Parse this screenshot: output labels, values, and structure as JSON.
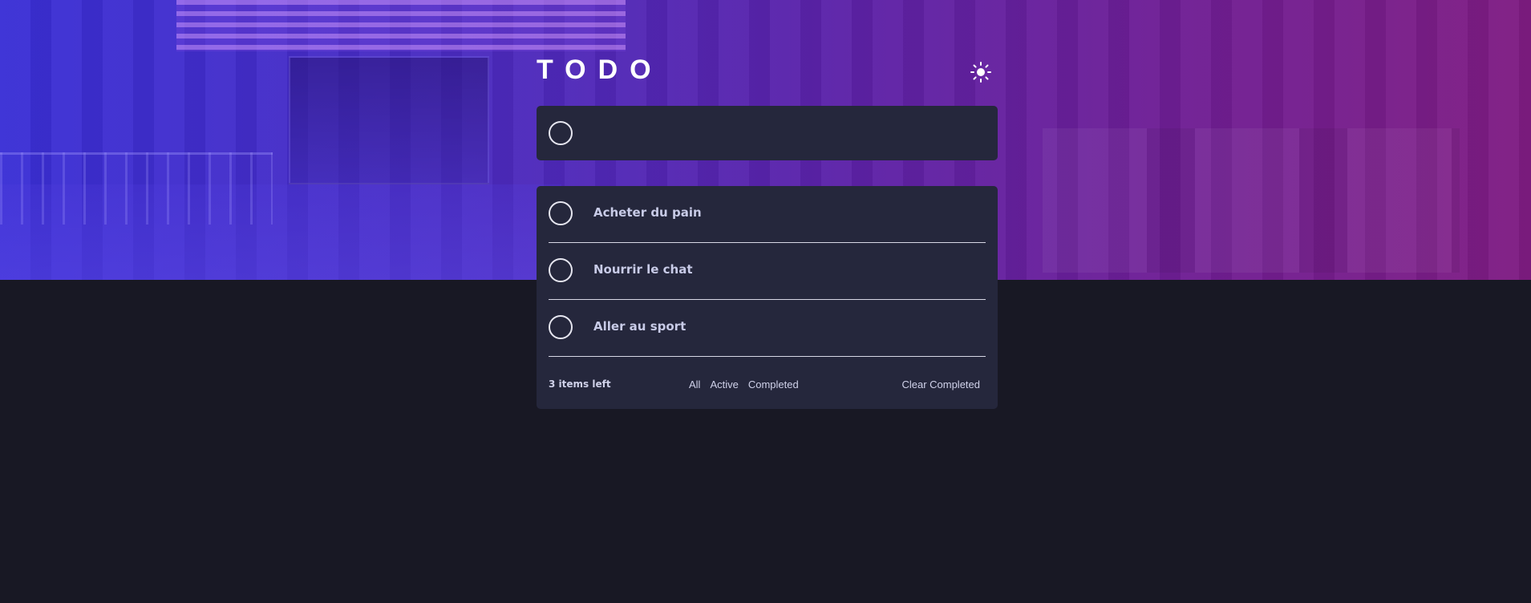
{
  "app": {
    "title": "TODO",
    "theme_icon": "sun-icon"
  },
  "new_todo": {
    "placeholder": "",
    "value": ""
  },
  "todos": [
    {
      "text": "Acheter du pain",
      "completed": false
    },
    {
      "text": "Nourrir le chat",
      "completed": false
    },
    {
      "text": "Aller au sport",
      "completed": false
    }
  ],
  "footer": {
    "items_left": "3 items left",
    "filters": [
      "All",
      "Active",
      "Completed"
    ],
    "clear_label": "Clear Completed"
  },
  "colors": {
    "page_bg": "#181824",
    "card_bg": "#25273c",
    "text": "#c8cbe7",
    "hero_start": "#3a2fd6",
    "hero_end": "#7f1c82"
  }
}
